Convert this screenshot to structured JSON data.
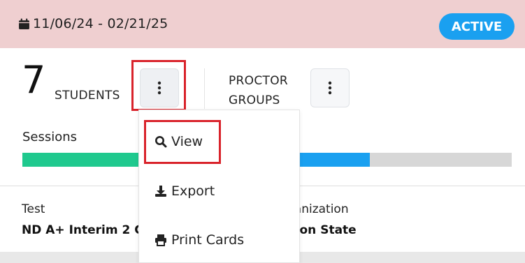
{
  "header": {
    "date_range": "11/06/24 - 02/21/25",
    "status": "ACTIVE",
    "calendar_icon": "calendar-icon"
  },
  "students": {
    "count": "7",
    "label": "STUDENTS"
  },
  "proctor": {
    "label_line1": "PROCTOR",
    "label_line2": "GROUPS"
  },
  "sessions": {
    "label": "Sessions",
    "progress_segments": [
      {
        "color": "#1fc98e",
        "fraction_start": 0.0,
        "fraction_end": 0.24
      },
      {
        "color": "#1aa0f0",
        "fraction_start": 0.56,
        "fraction_end": 0.71
      }
    ],
    "track_color": "#d7d7d7"
  },
  "details": {
    "test_label": "Test",
    "test_value": "ND A+ Interim 2 G",
    "organization_label": "ganization",
    "organization_value": "rson State"
  },
  "menu": {
    "items": [
      {
        "label": "View",
        "icon": "search-icon"
      },
      {
        "label": "Export",
        "icon": "download-icon"
      },
      {
        "label": "Print Cards",
        "icon": "print-icon"
      }
    ]
  },
  "colors": {
    "header_bg": "#efcfd0",
    "accent": "#1aa0f0",
    "highlight": "#d9232b"
  }
}
